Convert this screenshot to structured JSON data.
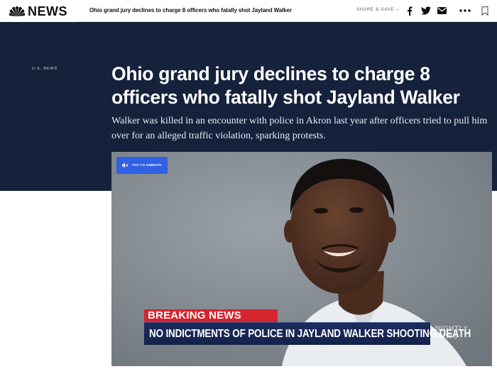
{
  "nav": {
    "logo_text": "NEWS",
    "article_title": "Ohio grand jury declines to charge 8 officers who fatally shot Jayland Walker",
    "share_save": "SHARE & SAVE",
    "share_chevron": "–"
  },
  "article": {
    "section": "U.S. NEWS",
    "headline": "Ohio grand jury declines to charge 8 officers who fatally shot Jayland Walker",
    "dek": "Walker was killed in an encounter with police in Akron last year after officers tried to pull him over for an alleged traffic violation, sparking protests."
  },
  "video": {
    "unmute_label": "TAP TO UNMUTE",
    "breaking_tag": "BREAKING NEWS",
    "chyron": "NO INDICTMENTS OF POLICE IN JAYLAND WALKER SHOOTING DEATH",
    "watermark": "NIGHTLY\nNEWS"
  },
  "icons": [
    "peacock-logo",
    "facebook-icon",
    "twitter-icon",
    "mail-icon",
    "more-icon",
    "bookmark-icon",
    "speaker-muted-icon"
  ],
  "colors": {
    "hero_bg": "#16213b",
    "unmute_bg": "#3061e3",
    "breaking_red": "#d4242d",
    "chyron_blue": "#1c2d5e"
  }
}
